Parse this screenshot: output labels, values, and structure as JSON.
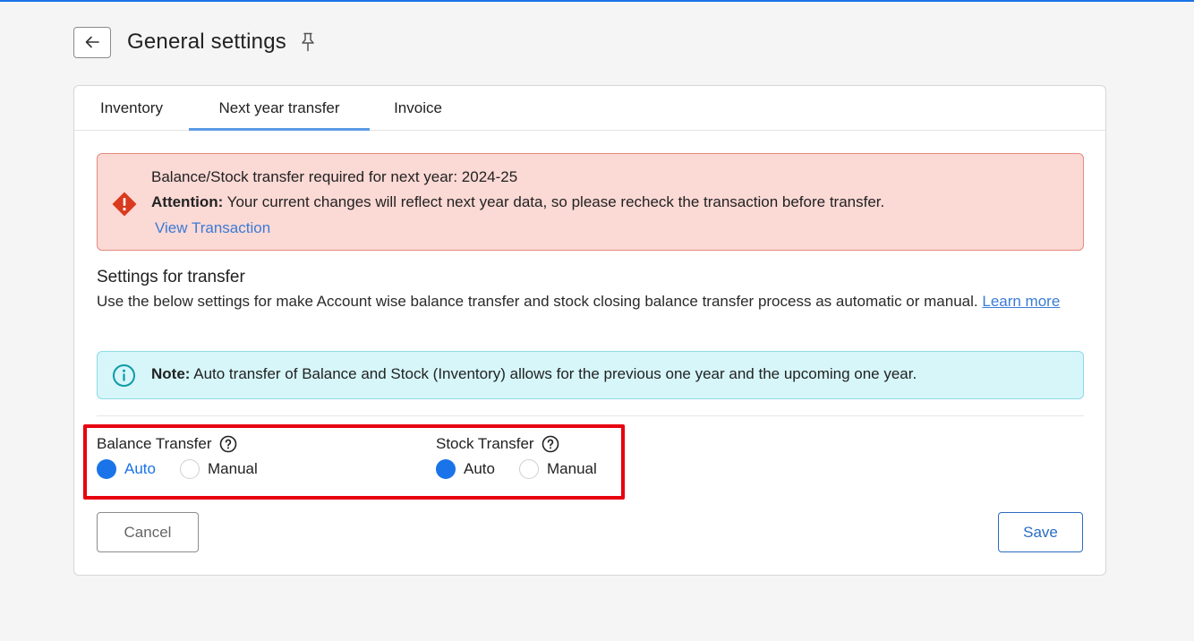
{
  "header": {
    "back_icon": "arrow-left-icon",
    "title": "General settings",
    "pin_icon": "pin-icon"
  },
  "tabs": [
    {
      "label": "Inventory",
      "active": false
    },
    {
      "label": "Next year transfer",
      "active": true
    },
    {
      "label": "Invoice",
      "active": false
    }
  ],
  "alert": {
    "icon": "warning-diamond-icon",
    "line1": "Balance/Stock transfer required for next year: 2024-25",
    "attention_label": "Attention:",
    "attention_text": " Your current changes will reflect next year data, so please recheck the transaction before transfer.",
    "link": "View Transaction",
    "bg_color": "#fbd9d5"
  },
  "settings": {
    "title": "Settings for transfer",
    "description": "Use the below settings for make Account wise balance transfer and stock closing balance transfer process as automatic or manual.",
    "learn_more": "Learn more"
  },
  "note": {
    "icon": "info-circle-icon",
    "label": "Note:",
    "text": " Auto transfer of Balance and Stock (Inventory) allows for the previous one year and the upcoming one year.",
    "bg_color": "#d6f6f9"
  },
  "balance_transfer": {
    "label": "Balance Transfer",
    "help_icon": "question-circle-icon",
    "options": [
      "Auto",
      "Manual"
    ],
    "selected": "Auto"
  },
  "stock_transfer": {
    "label": "Stock Transfer",
    "help_icon": "question-circle-icon",
    "options": [
      "Auto",
      "Manual"
    ],
    "selected": "Auto"
  },
  "actions": {
    "cancel": "Cancel",
    "save": "Save"
  },
  "colors": {
    "accent": "#1a73e8",
    "highlight_border": "#e8000f"
  }
}
